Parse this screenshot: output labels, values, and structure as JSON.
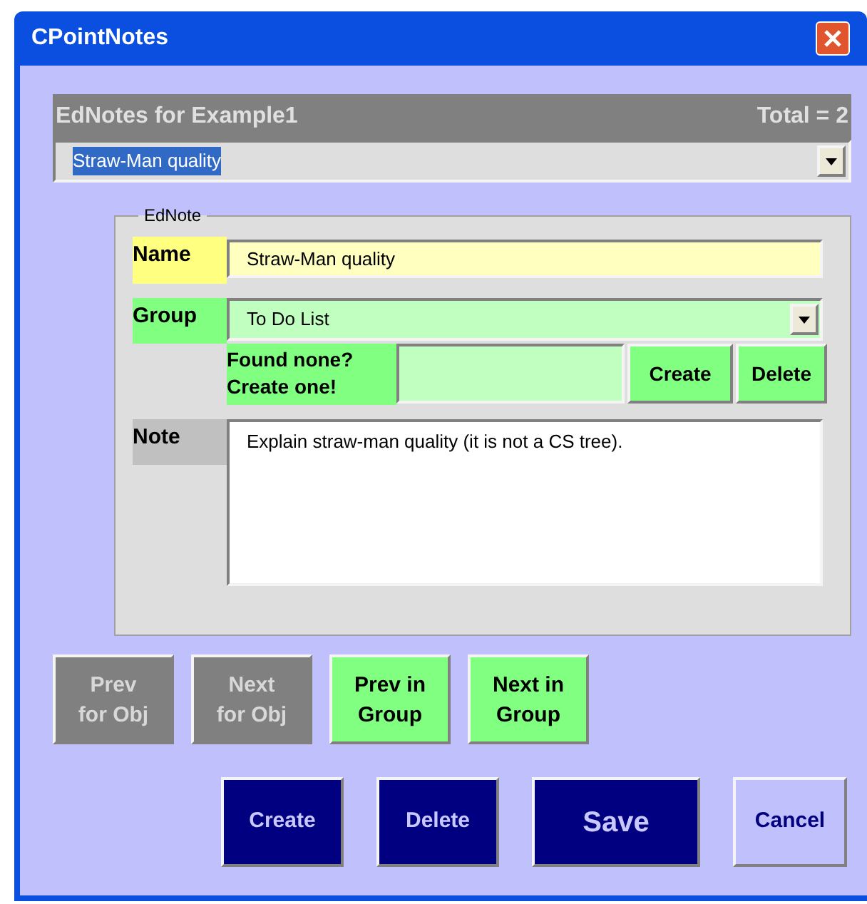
{
  "window": {
    "title": "CPointNotes"
  },
  "header": {
    "title": "EdNotes for Example1",
    "total": "Total = 2"
  },
  "note_select": {
    "value": "Straw-Man quality",
    "selected": true
  },
  "ednote": {
    "legend": "EdNote",
    "name_label": "Name",
    "name_value": "Straw-Man quality",
    "group_label": "Group",
    "group_value": "To Do List",
    "create_prompt": "Found none?\nCreate one!",
    "group_buttons": [
      "Create",
      "Delete"
    ],
    "note_label": "Note",
    "note_value": "Explain straw-man quality (it is not a CS tree)."
  },
  "nav_buttons": [
    {
      "label": "Prev\nfor Obj",
      "disabled": true
    },
    {
      "label": "Next\nfor Obj",
      "disabled": true
    },
    {
      "label": "Prev in\nGroup",
      "disabled": false
    },
    {
      "label": "Next in\nGroup",
      "disabled": false
    }
  ],
  "buttons": [
    {
      "label": "Create",
      "kind": "primary"
    },
    {
      "label": "Delete",
      "kind": "primary"
    },
    {
      "label": "Save",
      "kind": "large"
    },
    {
      "label": "Cancel",
      "kind": "secondary"
    }
  ]
}
